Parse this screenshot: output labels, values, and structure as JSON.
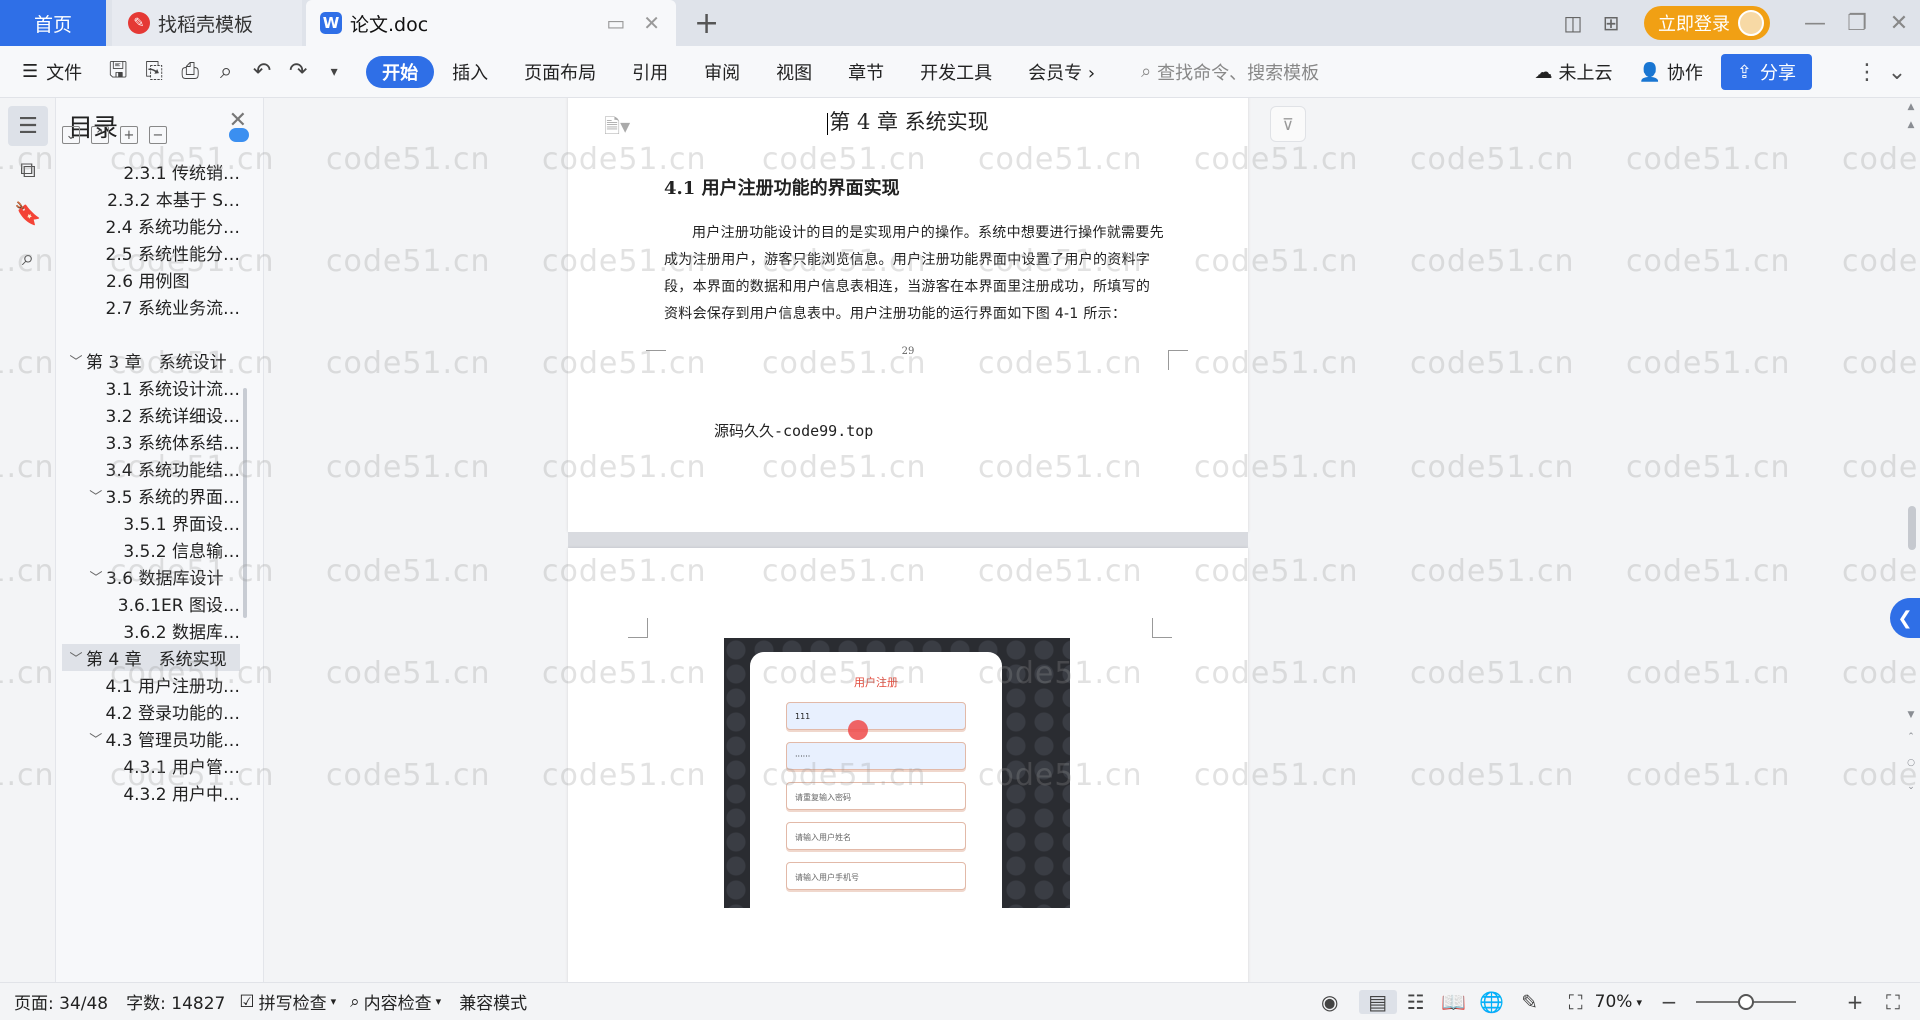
{
  "tabs": {
    "home": "首页",
    "template": "找稻壳模板",
    "document": "论文.doc",
    "new_tab": "+"
  },
  "titlebar": {
    "login": "立即登录"
  },
  "ribbon": {
    "file": "文件",
    "tabs": [
      "开始",
      "插入",
      "页面布局",
      "引用",
      "审阅",
      "视图",
      "章节",
      "开发工具",
      "会员专"
    ],
    "search_placeholder": "查找命令、搜索模板",
    "cloud": "未上云",
    "collab": "协作",
    "share": "分享"
  },
  "toc": {
    "title": "目录",
    "items": [
      {
        "label": "2.3.1 传统销…",
        "level": 3,
        "chev": ""
      },
      {
        "label": "2.3.2 本基于 S…",
        "level": 3,
        "chev": ""
      },
      {
        "label": "2.4 系统功能分…",
        "level": 2,
        "chev": ""
      },
      {
        "label": "2.5 系统性能分…",
        "level": 2,
        "chev": ""
      },
      {
        "label": "2.6 用例图",
        "level": 2,
        "chev": ""
      },
      {
        "label": "2.7 系统业务流…",
        "level": 2,
        "chev": ""
      },
      {
        "label": "",
        "level": 2,
        "chev": ""
      },
      {
        "label": "第 3 章　系统设计",
        "level": 1,
        "chev": "v"
      },
      {
        "label": "3.1 系统设计流…",
        "level": 2,
        "chev": ""
      },
      {
        "label": "3.2 系统详细设…",
        "level": 2,
        "chev": ""
      },
      {
        "label": "3.3 系统体系结…",
        "level": 2,
        "chev": ""
      },
      {
        "label": "3.4 系统功能结…",
        "level": 2,
        "chev": ""
      },
      {
        "label": "3.5 系统的界面…",
        "level": 2,
        "chev": "v"
      },
      {
        "label": "3.5.1 界面设…",
        "level": 3,
        "chev": ""
      },
      {
        "label": "3.5.2 信息输…",
        "level": 3,
        "chev": ""
      },
      {
        "label": "3.6 数据库设计",
        "level": 2,
        "chev": "v"
      },
      {
        "label": "3.6.1ER 图设…",
        "level": 3,
        "chev": ""
      },
      {
        "label": "3.6.2 数据库…",
        "level": 3,
        "chev": ""
      },
      {
        "label": "第 4 章　系统实现",
        "level": 1,
        "chev": "v",
        "active": true
      },
      {
        "label": "4.1 用户注册功…",
        "level": 2,
        "chev": ""
      },
      {
        "label": "4.2 登录功能的…",
        "level": 2,
        "chev": ""
      },
      {
        "label": "4.3 管理员功能…",
        "level": 2,
        "chev": "v"
      },
      {
        "label": "4.3.1 用户管…",
        "level": 3,
        "chev": ""
      },
      {
        "label": "4.3.2 用户中…",
        "level": 3,
        "chev": ""
      }
    ]
  },
  "document": {
    "chapter_title": "第 4 章  系统实现",
    "section_title": "4.1 用户注册功能的界面实现",
    "paragraph": "用户注册功能设计的目的是实现用户的操作。系统中想要进行操作就需要先成为注册用户，游客只能浏览信息。用户注册功能界面中设置了用户的资料字段，本界面的数据和用户信息表相连，当游客在本界面里注册成功，所填写的资料会保存到用户信息表中。用户注册功能的运行界面如下图 4-1 所示：",
    "page_number": "29",
    "footer_text": "源码久久-code99.top",
    "watermark": "code51.cn"
  },
  "screenshot_form": {
    "title": "用户注册",
    "fields": [
      {
        "value": "111",
        "filled": true
      },
      {
        "value": "······",
        "filled": true
      },
      {
        "value": "请重复输入密码",
        "filled": false
      },
      {
        "value": "请输入用户姓名",
        "filled": false
      },
      {
        "value": "请输入用户手机号",
        "filled": false
      }
    ]
  },
  "status": {
    "page": "页面: 34/48",
    "words": "字数: 14827",
    "spell": "拼写检查",
    "content": "内容检查",
    "compat": "兼容模式",
    "zoom": "70%",
    "zoom_level_percent": 70
  }
}
